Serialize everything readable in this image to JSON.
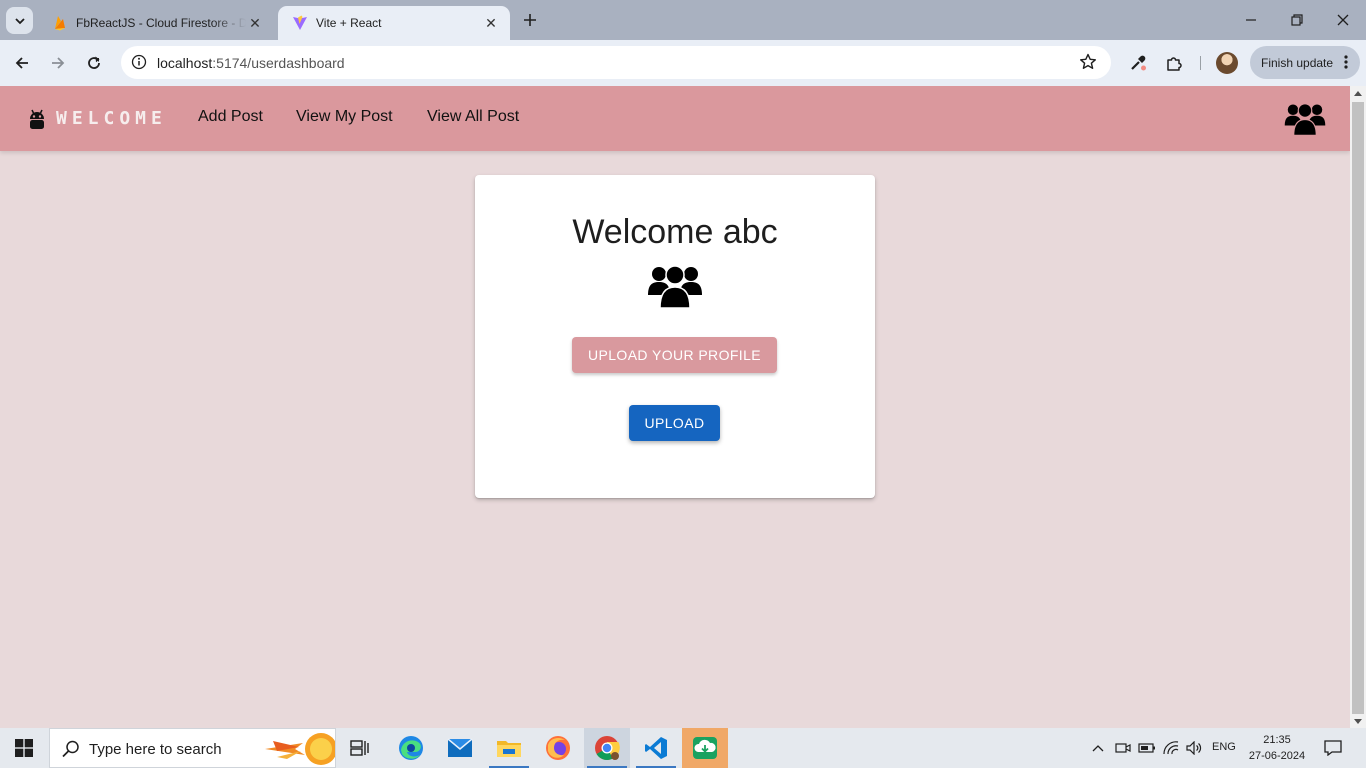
{
  "browser": {
    "tabs": [
      {
        "title": "FbReactJS - Cloud Firestore - Data",
        "active": false
      },
      {
        "title": "Vite + React",
        "active": true
      }
    ],
    "url_host": "localhost",
    "url_path": ":5174/userdashboard",
    "finish_update_label": "Finish update"
  },
  "app": {
    "brand": "WELCOME",
    "nav": [
      "Add Post",
      "View My Post",
      "View All Post"
    ],
    "card": {
      "greeting": "Welcome abc",
      "upload_profile_label": "UPLOAD YOUR PROFILE",
      "upload_label": "UPLOAD"
    },
    "colors": {
      "appbar": "#da989d",
      "page_bg": "#e8d9da",
      "upload_profile_button": "#d9999e",
      "upload_button": "#1565c0"
    }
  },
  "taskbar": {
    "search_placeholder": "Type here to search",
    "apps": [
      "task-view",
      "edge",
      "mail",
      "file-explorer",
      "firefox",
      "chrome",
      "vscode",
      "downloader"
    ],
    "language": "ENG",
    "time": "21:35",
    "date": "27-06-2024"
  }
}
